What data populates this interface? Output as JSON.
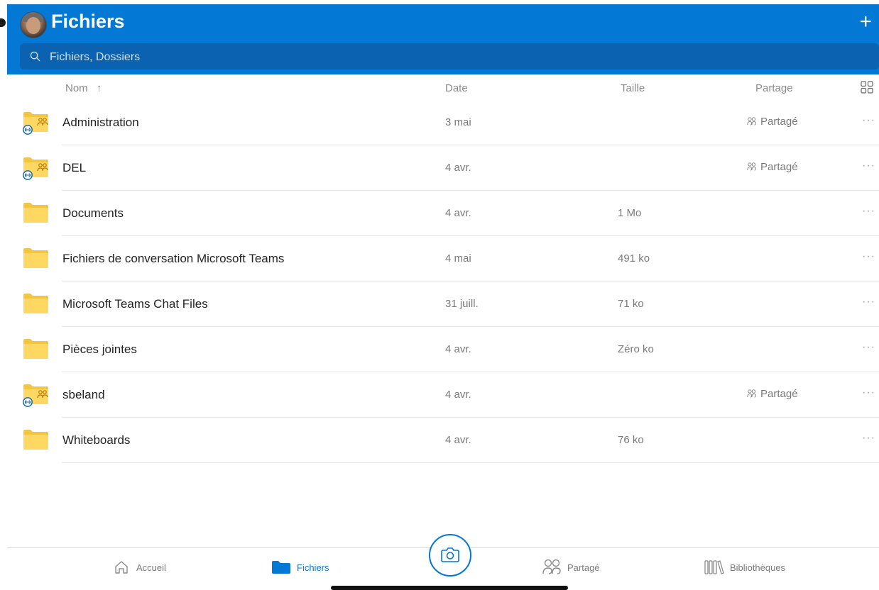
{
  "header": {
    "title": "Fichiers",
    "search_placeholder": "Fichiers, Dossiers",
    "add_icon": "plus-icon",
    "accent_color": "#0378d4"
  },
  "columns": {
    "name": "Nom",
    "name_sort": "↑",
    "date": "Date",
    "size": "Taille",
    "sharing": "Partage",
    "view_toggle_icon": "grid-view-icon"
  },
  "files": [
    {
      "name": "Administration",
      "date": "3 mai",
      "size": "",
      "sharing": "Partagé",
      "shared": true
    },
    {
      "name": "DEL",
      "date": "4 avr.",
      "size": "",
      "sharing": "Partagé",
      "shared": true
    },
    {
      "name": "Documents",
      "date": "4 avr.",
      "size": "1 Mo",
      "sharing": "",
      "shared": false
    },
    {
      "name": "Fichiers de conversation Microsoft Teams",
      "date": "4 mai",
      "size": "491 ko",
      "sharing": "",
      "shared": false
    },
    {
      "name": "Microsoft Teams Chat Files",
      "date": "31 juill.",
      "size": "71 ko",
      "sharing": "",
      "shared": false
    },
    {
      "name": "Pièces jointes",
      "date": "4 avr.",
      "size": "Zéro ko",
      "sharing": "",
      "shared": false
    },
    {
      "name": "sbeland",
      "date": "4 avr.",
      "size": "",
      "sharing": "Partagé",
      "shared": true
    },
    {
      "name": "Whiteboards",
      "date": "4 avr.",
      "size": "76 ko",
      "sharing": "",
      "shared": false
    }
  ],
  "tabbar": {
    "home": "Accueil",
    "files": "Fichiers",
    "shared": "Partagé",
    "libraries": "Bibliothèques",
    "active": "Fichiers",
    "camera_icon": "camera-icon"
  }
}
